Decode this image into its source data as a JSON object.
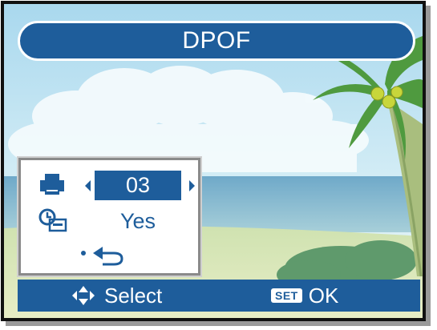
{
  "title": "DPOF",
  "menu": {
    "copies": {
      "icon": "printer-icon",
      "value": "03"
    },
    "date_stamp": {
      "icon": "date-stamp-icon",
      "value": "Yes"
    },
    "back": {
      "icon": "return-icon"
    }
  },
  "footer": {
    "nav_label": "Select",
    "nav_icon": "four-way-arrows-icon",
    "set_badge": "SET",
    "ok_label": "OK"
  },
  "colors": {
    "accent": "#1e5d9b",
    "sky_top": "#bde3f2",
    "sea": "#7fb4cf",
    "sand": "#d8e6b6",
    "palm_green": "#3f8f3c"
  }
}
